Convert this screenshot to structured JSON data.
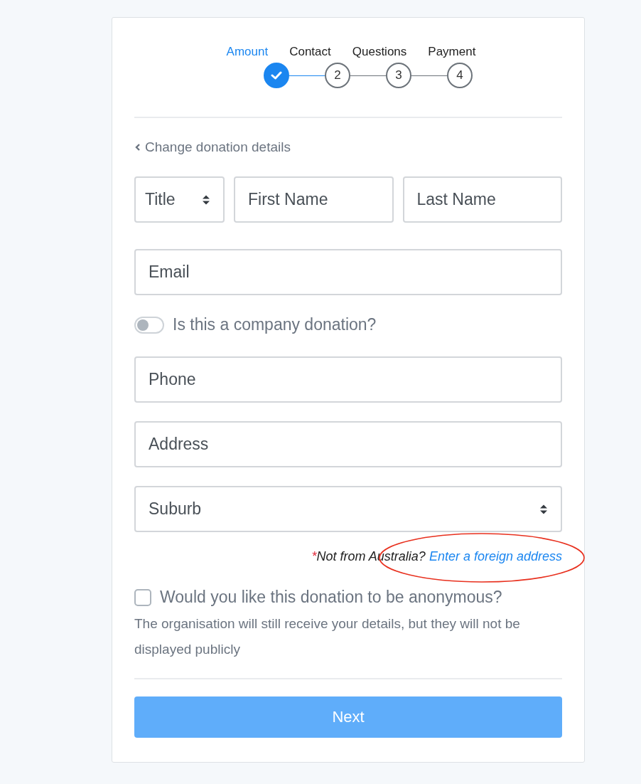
{
  "steps": [
    {
      "label": "Amount",
      "done": true,
      "selected": true
    },
    {
      "label": "Contact",
      "number": "2",
      "done": false,
      "selected": false
    },
    {
      "label": "Questions",
      "number": "3",
      "done": false,
      "selected": false
    },
    {
      "label": "Payment",
      "number": "4",
      "done": false,
      "selected": false
    }
  ],
  "back_link": "Change donation details",
  "field_rows": [
    [
      {
        "kind": "select",
        "placeholder": "Title"
      },
      {
        "kind": "text",
        "placeholder": "First Name"
      },
      {
        "kind": "text",
        "placeholder": "Last Name"
      }
    ],
    [
      {
        "kind": "text",
        "placeholder": "Email"
      }
    ],
    [
      {
        "kind": "toggle",
        "label": "Is this a company donation?",
        "on": false
      }
    ],
    [
      {
        "kind": "text",
        "placeholder": "Phone"
      }
    ],
    [
      {
        "kind": "text",
        "placeholder": "Address"
      }
    ],
    [
      {
        "kind": "select",
        "placeholder": "Suburb"
      }
    ]
  ],
  "foreign_note": {
    "mark": "*",
    "text": "Not from Australia?",
    "link": "Enter a foreign address"
  },
  "annotation": {
    "kind": "ellipse"
  },
  "anonymous": {
    "label": "Would you like this donation to be anonymous?",
    "checked": false,
    "help": "The organisation will still receive your details, but they will not be displayed publicly"
  },
  "next_button": "Next"
}
